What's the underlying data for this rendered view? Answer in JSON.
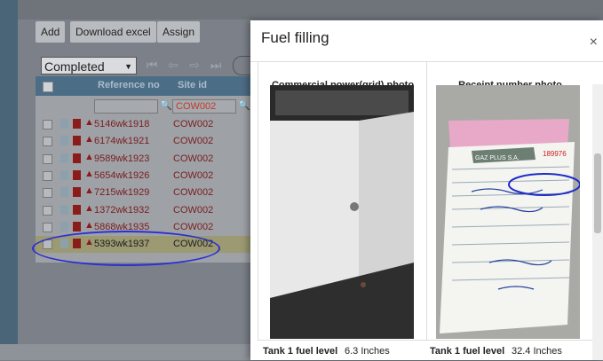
{
  "toolbar": {
    "add_label": "Add",
    "download_label": "Download excel",
    "assign_label": "Assign"
  },
  "status_select": {
    "value": "Completed"
  },
  "grid": {
    "headers": {
      "reference": "Reference no",
      "site": "Site id"
    },
    "filter_site_value": "COW002",
    "rows": [
      {
        "ref": "5146wk1918",
        "site": "COW002"
      },
      {
        "ref": "6174wk1921",
        "site": "COW002"
      },
      {
        "ref": "9589wk1923",
        "site": "COW002"
      },
      {
        "ref": "5654wk1926",
        "site": "COW002"
      },
      {
        "ref": "7215wk1929",
        "site": "COW002"
      },
      {
        "ref": "1372wk1932",
        "site": "COW002"
      },
      {
        "ref": "5868wk1935",
        "site": "COW002"
      },
      {
        "ref": "5393wk1937",
        "site": "COW002"
      }
    ]
  },
  "modal": {
    "title": "Fuel filling",
    "close_glyph": "×",
    "col1_title": "Commercial power(grid) photo",
    "col2_title": "Receipt number photo",
    "tank1_label": "Tank 1 fuel level",
    "tank1_value_a": "6.3 Inches",
    "tank1_value_b": "32.4 Inches",
    "receipt_header_text": "GAZ PLUS S.A.",
    "receipt_number": "189976"
  },
  "colors": {
    "annotation_blue": "#2d2fd0",
    "link_red": "#7b1d1d"
  }
}
